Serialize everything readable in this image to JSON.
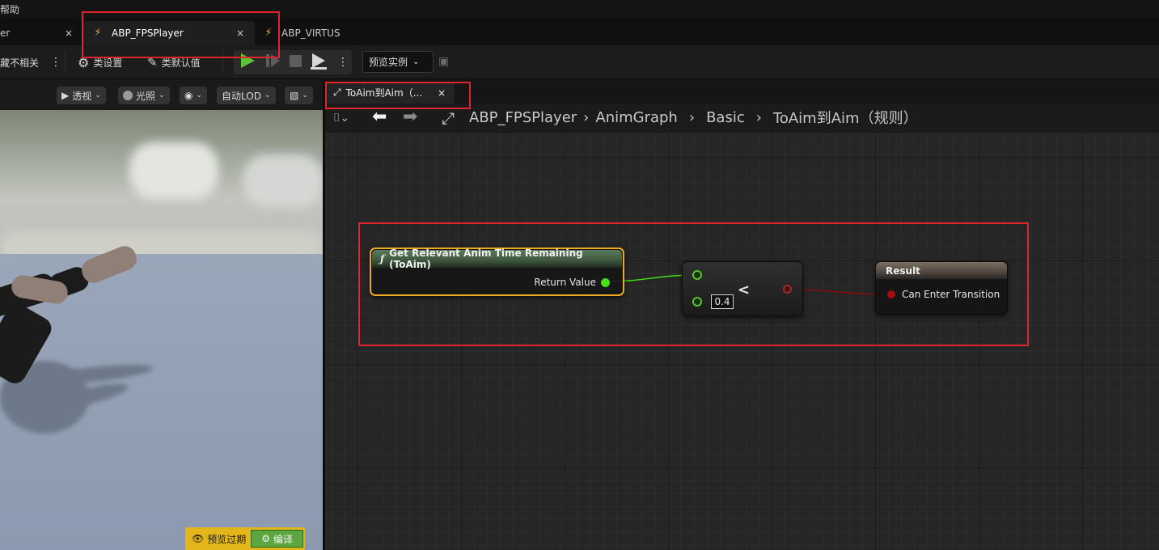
{
  "menu": {
    "help": "帮助"
  },
  "doc_tabs": [
    {
      "label": "er",
      "close": "×"
    },
    {
      "label": "ABP_FPSPlayer",
      "close": "×",
      "active": true
    },
    {
      "label": "ABP_VIRTUS"
    }
  ],
  "toolbar": {
    "hide_unrelated": "藏不相关",
    "class_settings": "类设置",
    "class_defaults": "类默认值",
    "preview_instance": "预览实例"
  },
  "viewport": {
    "perspective": "透视",
    "lighting": "光照",
    "lod": "自动LOD",
    "preview_stale": "预览过期",
    "compile": "编译"
  },
  "graph_tab": {
    "label": "ToAim到Aim（...",
    "close": "×"
  },
  "breadcrumbs": [
    "ABP_FPSPlayer",
    "AnimGraph",
    "Basic",
    "ToAim到Aim（规则）"
  ],
  "nodes": {
    "func": {
      "title": "Get Relevant Anim Time Remaining (ToAim)",
      "output": "Return Value"
    },
    "compare": {
      "operator": "<",
      "value": "0.4"
    },
    "result": {
      "title": "Result",
      "input": "Can Enter Transition"
    }
  },
  "colors": {
    "highlight_border": "#e0242a",
    "selected_node": "#f0a722",
    "float_pin": "#44e016",
    "bool_pin": "#a30d0d",
    "compile_button": "#5ba63e",
    "stale_badge": "#e3b61a"
  }
}
